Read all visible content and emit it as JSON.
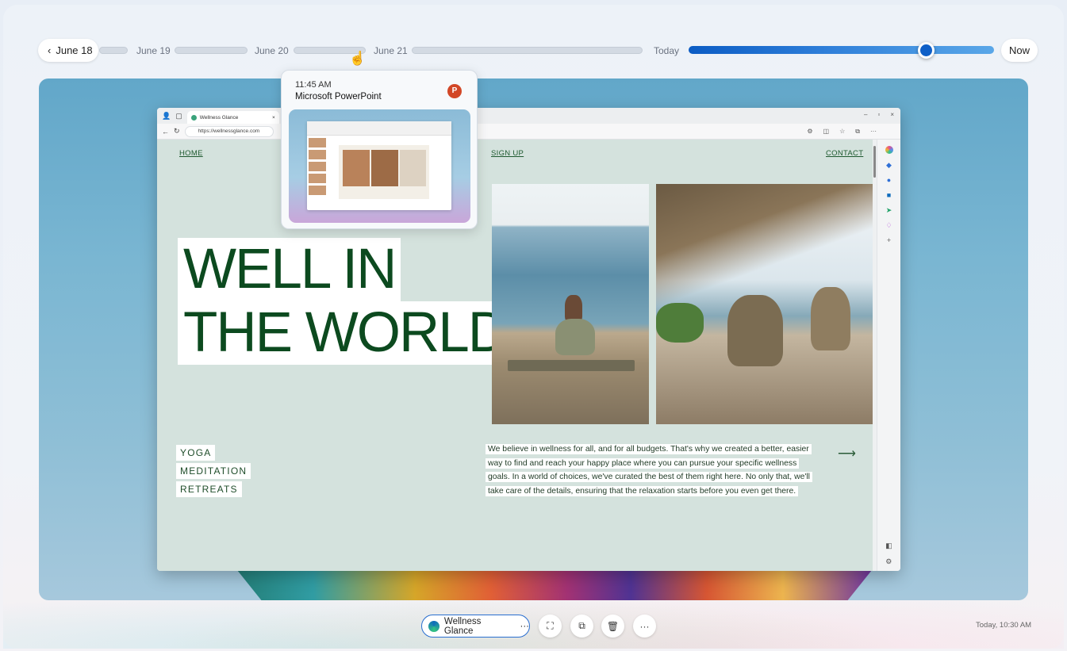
{
  "timeline": {
    "back_label": "June 18",
    "dates": [
      "June 19",
      "June 20",
      "June 21",
      "Today"
    ],
    "now_label": "Now",
    "position": 0.81
  },
  "popup": {
    "time": "11:45 AM",
    "app": "Microsoft PowerPoint",
    "app_icon": "powerpoint-icon"
  },
  "browser": {
    "tab_title": "Wellness Glance",
    "url": "https://wellnessglance.com",
    "nav": {
      "home": "HOME",
      "signup": "SIGN UP",
      "contact": "CONTACT"
    },
    "hero": [
      "WELL IN",
      "THE WORLD"
    ],
    "tags": [
      "YOGA",
      "MEDITATION",
      "RETREATS"
    ],
    "blurb_lines": [
      "We believe in wellness for all, and for all budgets. That's why we created a better, easier",
      "way to find and reach your happy place where you can pursue your specific wellness",
      "goals. In a world of choices, we've curated the best of them right here. No only that, we'll",
      "take care of the details, ensuring that the relaxation starts before you even get there."
    ],
    "arrow": "⟶"
  },
  "bottom": {
    "app_label": "Wellness Glance",
    "more": "···",
    "timestamp": "Today, 10:30 AM"
  },
  "colors": {
    "accent": "#0f5fc7",
    "hero_green": "#0c4a1f",
    "page_bg": "#d4e2dd"
  }
}
